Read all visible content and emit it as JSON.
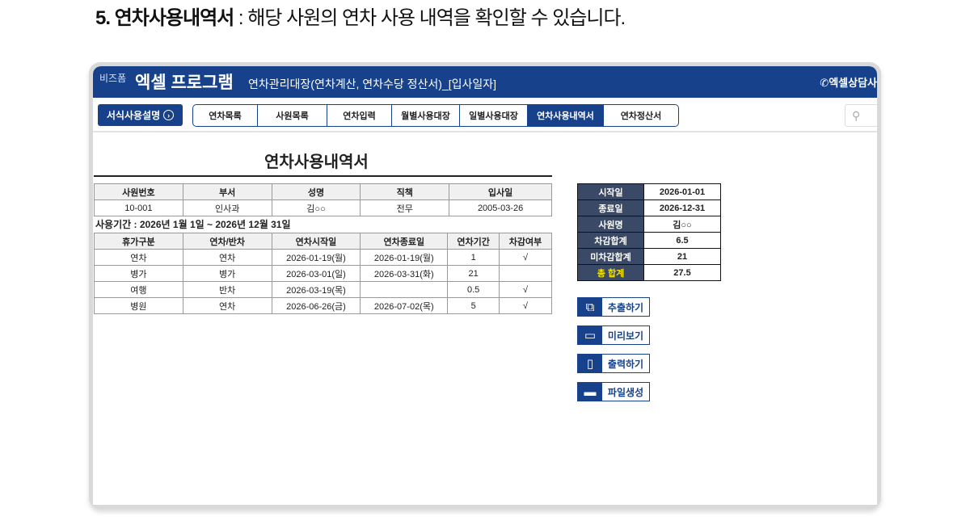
{
  "heading": {
    "number": "5. 연차사용내역서",
    "desc": " : 해당 사원의 연차 사용 내역을 확인할 수 있습니다."
  },
  "header": {
    "brand_small": "비즈폼",
    "brand": "엑셀 프로그램",
    "subtitle": "연차관리대장(연차계산, 연차수당 정산서)_[입사일자]",
    "consult": "엑셀상담사"
  },
  "nav": {
    "guide": "서식사용설명",
    "tabs": [
      "연차목록",
      "사원목록",
      "연차입력",
      "월별사용대장",
      "일별사용대장",
      "연차사용내역서",
      "연차정산서"
    ],
    "active": 5
  },
  "page_title": "연차사용내역서",
  "employee": {
    "headers": [
      "사원번호",
      "부서",
      "성명",
      "직책",
      "입사일"
    ],
    "values": [
      "10-001",
      "인사과",
      "김○○",
      "전무",
      "2005-03-26"
    ]
  },
  "period": "사용기간 : 2026년 1월 1일 ~ 2026년 12월 31일",
  "usage": {
    "headers": [
      "휴가구분",
      "연차/반차",
      "연차시작일",
      "연차종료일",
      "연차기간",
      "차감여부"
    ],
    "rows": [
      [
        "연차",
        "연차",
        "2026-01-19(월)",
        "2026-01-19(월)",
        "1",
        "√"
      ],
      [
        "병가",
        "병가",
        "2026-03-01(일)",
        "2026-03-31(화)",
        "21",
        ""
      ],
      [
        "여행",
        "반차",
        "2026-03-19(목)",
        "",
        "0.5",
        "√"
      ],
      [
        "병원",
        "연차",
        "2026-06-26(금)",
        "2026-07-02(목)",
        "5",
        "√"
      ]
    ]
  },
  "summary": [
    {
      "k": "시작일",
      "v": "2026-01-01"
    },
    {
      "k": "종료일",
      "v": "2026-12-31"
    },
    {
      "k": "사원명",
      "v": "김○○"
    },
    {
      "k": "차감합계",
      "v": "6.5"
    },
    {
      "k": "미차감합계",
      "v": "21"
    },
    {
      "k": "총 합계",
      "v": "27.5"
    }
  ],
  "buttons": [
    {
      "label": "추출하기",
      "icon": "copy-icon"
    },
    {
      "label": "미리보기",
      "icon": "monitor-icon"
    },
    {
      "label": "출력하기",
      "icon": "print-icon"
    },
    {
      "label": "파일생성",
      "icon": "folder-icon"
    }
  ],
  "colors": {
    "brand": "#17428b",
    "summary_header": "#3a4a66",
    "total_label": "#f5e400"
  }
}
